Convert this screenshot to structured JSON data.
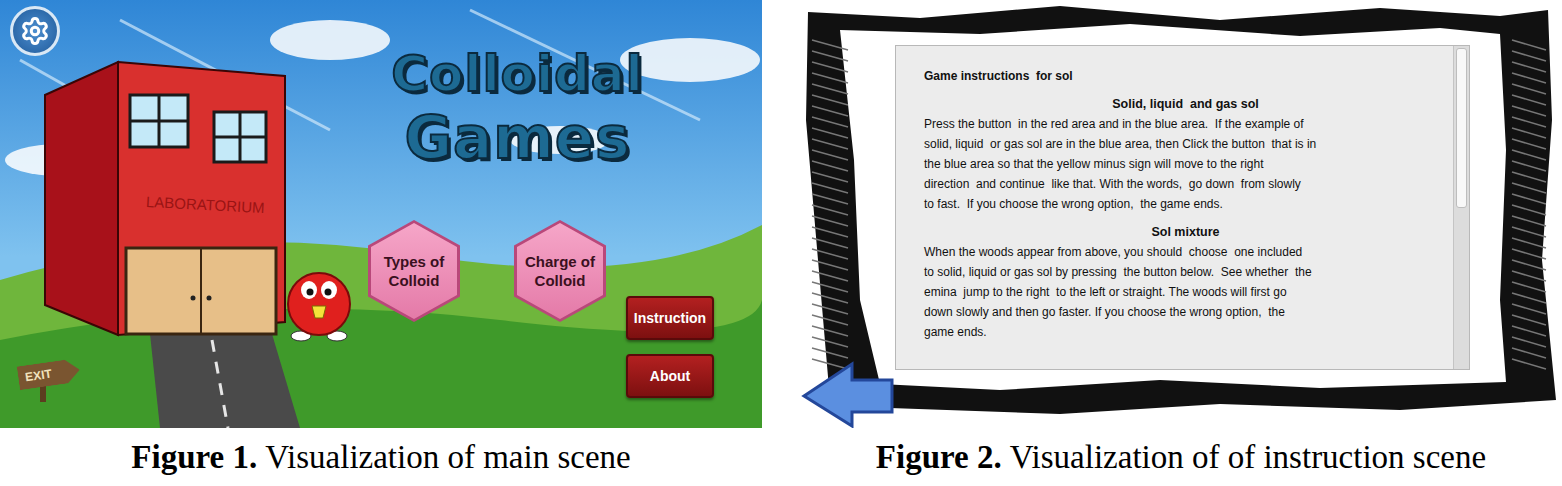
{
  "figures": [
    {
      "label": "Figure 1.",
      "caption": "Visualization of main scene"
    },
    {
      "label": "Figure 2.",
      "caption": "Visualization of of instruction scene"
    }
  ],
  "main_scene": {
    "title_lines": [
      "Colloidal",
      "Games"
    ],
    "building_label": "LABORATORIUM",
    "menu_buttons": [
      "Types of Colloid",
      "Charge of Colloid"
    ],
    "buttons": [
      "Instruction",
      "About"
    ],
    "exit_sign": "EXIT"
  },
  "instruction_scene": {
    "heading": "Game instructions  for sol",
    "sections": [
      {
        "title": "Solid, liquid  and gas sol",
        "lines": [
          "Press the button  in the red area and in the blue area.  If the example of",
          "solid, liquid  or gas sol are in the blue area, then Click the button  that is in",
          "the blue area so that the yellow minus sign will move to the right",
          "direction  and continue  like that. With the words,  go down  from slowly",
          "to fast.  If you choose the wrong option,  the game ends."
        ]
      },
      {
        "title": "Sol mixture",
        "lines": [
          "When the woods appear from above, you should  choose  one included",
          "to solid, liquid or gas sol by pressing  the button below.  See whether  the",
          "emina  jump to the right  to the left or straight. The woods will first go",
          "down slowly and then go faster. If you choose the wrong option,  the",
          "game ends."
        ]
      }
    ],
    "scrollbar": {
      "level": 0.5
    }
  }
}
